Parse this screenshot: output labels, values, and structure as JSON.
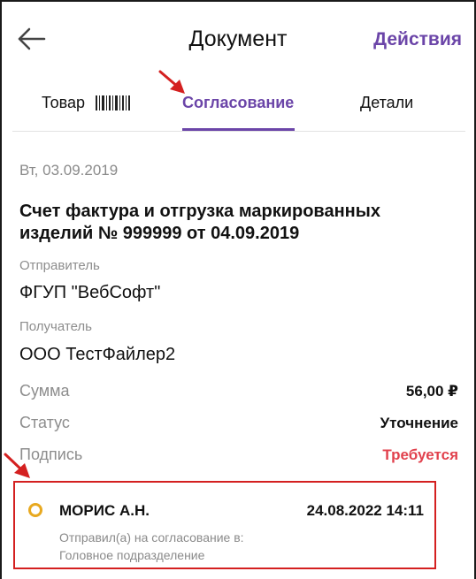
{
  "header": {
    "title": "Документ",
    "actions_label": "Действия"
  },
  "tabs": [
    {
      "label": "Товар",
      "active": false
    },
    {
      "label": "Согласование",
      "active": true
    },
    {
      "label": "Детали",
      "active": false
    }
  ],
  "document": {
    "date": "Вт, 03.09.2019",
    "title": "Счет фактура и отгрузка маркированных изделий № 999999 от 04.09.2019",
    "sender_label": "Отправитель",
    "sender_value": "ФГУП \"ВебСофт\"",
    "recipient_label": "Получатель",
    "recipient_value": "ООО ТестФайлер2",
    "rows": [
      {
        "label": "Сумма",
        "value": "56,00 ₽"
      },
      {
        "label": "Статус",
        "value": "Уточнение"
      },
      {
        "label": "Подпись",
        "value": "Требуется"
      }
    ]
  },
  "signature": {
    "name": "МОРИС А.Н.",
    "datetime": "24.08.2022 14:11",
    "description_line1": "Отправил(а) на согласование в:",
    "description_line2": "Головное подразделение"
  },
  "colors": {
    "accent": "#6b45a8",
    "required": "#e1414d",
    "pending_dot": "#e8a920",
    "annotation": "#d42020"
  }
}
